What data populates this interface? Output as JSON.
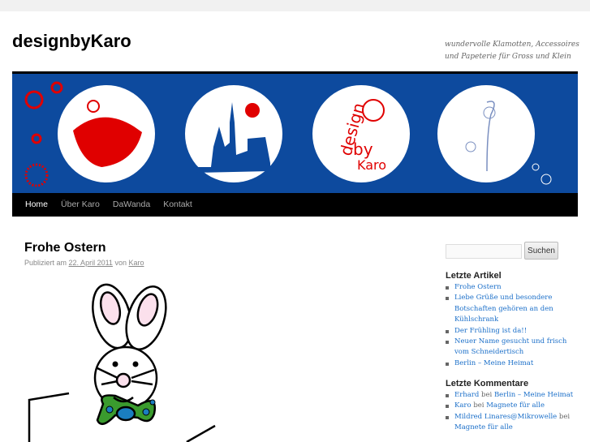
{
  "site": {
    "title": "designbyKaro",
    "description": "wundervolle Klamotten, Accessoires und Papeterie für Gross und Klein"
  },
  "nav": [
    "Home",
    "Über Karo",
    "DaWanda",
    "Kontakt"
  ],
  "post": {
    "title": "Frohe Ostern",
    "meta_prefix": "Publiziert am",
    "date": "22. April 2011",
    "meta_by": "von",
    "author": "Karo"
  },
  "search": {
    "placeholder": "",
    "button": "Suchen"
  },
  "recent_posts": {
    "title": "Letzte Artikel",
    "items": [
      "Frohe Ostern",
      "Liebe Grüße und besondere Botschaften gehören an den Kühlschrank",
      "Der Frühling ist da!!",
      "Neuer Name gesucht und frisch vom Schneidertisch",
      "Berlin – Meine Heimat"
    ]
  },
  "recent_comments": {
    "title": "Letzte Kommentare",
    "connector": "bei",
    "items": [
      {
        "author": "Erhard",
        "post": "Berlin – Meine Heimat"
      },
      {
        "author": "Karo",
        "post": "Magnete für alle"
      },
      {
        "author": "Mildred Linares@Mikrowelle",
        "post": "Magnete für alle"
      }
    ]
  },
  "banner": {
    "logo_text": "design by Karo"
  },
  "colors": {
    "banner": "#0d4a9e",
    "red": "#e00000",
    "link": "#1b6fc9"
  }
}
